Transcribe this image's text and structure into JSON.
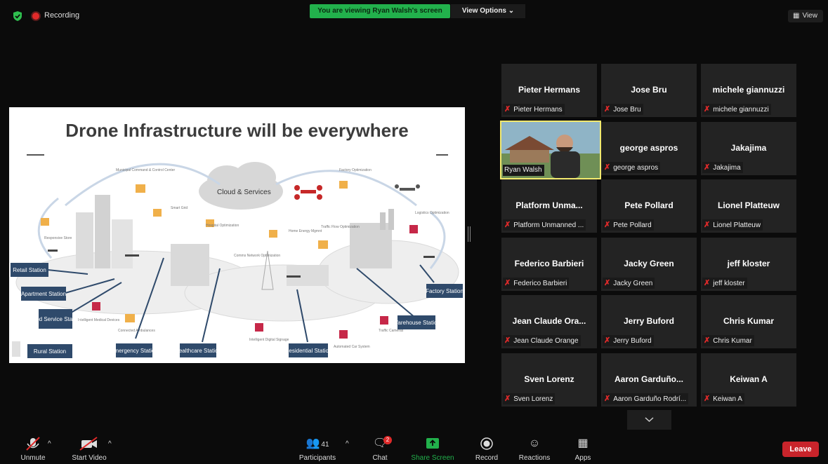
{
  "top": {
    "recording_label": "Recording",
    "viewing_banner": "You are viewing Ryan Walsh's screen",
    "view_options": "View Options",
    "view_button": "View"
  },
  "slide": {
    "title": "Drone Infrastructure will be everywhere",
    "cloud_label": "Cloud & Services",
    "stations": [
      "Retail Station",
      "Apartment Station",
      "Food Service Station",
      "Rural Station",
      "Emergency Station",
      "Healthcare Station",
      "Residential Station",
      "Warehouse Station",
      "Factory Station"
    ],
    "small_labels": [
      "Municipal Command & Control Center",
      "Factory Optimization",
      "Logistics Optimization",
      "Smart Grid",
      "Hospital Optimization",
      "Home Energy Mgmnt",
      "Traffic Flow Optimization",
      "Responsive Store",
      "Comms Network Optimization",
      "Intelligent Medical Devices",
      "Connected Ambulances",
      "Intelligent Digital Signage",
      "Automated Car System",
      "Traffic Cameras"
    ]
  },
  "participants": [
    {
      "display": "Pieter Hermans",
      "label": "Pieter Hermans"
    },
    {
      "display": "Jose Bru",
      "label": "Jose Bru"
    },
    {
      "display": "michele giannuzzi",
      "label": "michele giannuzzi"
    },
    {
      "display": "",
      "label": "Ryan Walsh",
      "video": true
    },
    {
      "display": "george aspros",
      "label": "george aspros"
    },
    {
      "display": "Jakajima",
      "label": "Jakajima"
    },
    {
      "display": "Platform Unma...",
      "label": "Platform Unmanned ..."
    },
    {
      "display": "Pete Pollard",
      "label": "Pete Pollard"
    },
    {
      "display": "Lionel Platteuw",
      "label": "Lionel Platteuw"
    },
    {
      "display": "Federico Barbieri",
      "label": "Federico Barbieri"
    },
    {
      "display": "Jacky Green",
      "label": "Jacky Green"
    },
    {
      "display": "jeff kloster",
      "label": "jeff kloster"
    },
    {
      "display": "Jean Claude Ora...",
      "label": "Jean Claude Orange"
    },
    {
      "display": "Jerry Buford",
      "label": "Jerry Buford"
    },
    {
      "display": "Chris Kumar",
      "label": "Chris Kumar"
    },
    {
      "display": "Sven Lorenz",
      "label": "Sven Lorenz"
    },
    {
      "display": "Aaron Garduño...",
      "label": "Aaron Garduño Rodrí..."
    },
    {
      "display": "Keiwan A",
      "label": "Keiwan A"
    }
  ],
  "toolbar": {
    "unmute": "Unmute",
    "start_video": "Start Video",
    "participants": "Participants",
    "participants_count": "41",
    "chat": "Chat",
    "chat_badge": "2",
    "share_screen": "Share Screen",
    "record": "Record",
    "reactions": "Reactions",
    "apps": "Apps",
    "leave": "Leave"
  },
  "colors": {
    "accent_green": "#22b14c",
    "leave_red": "#c8242b",
    "active_speaker": "#f2e96e",
    "muted_red": "#e02a2a"
  }
}
